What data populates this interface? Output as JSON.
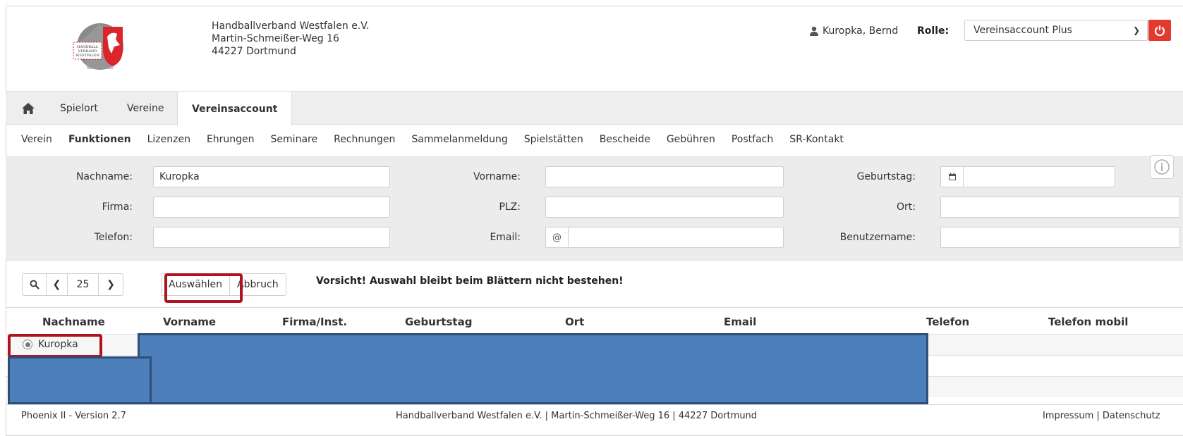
{
  "header": {
    "org_name": "Handballverband Westfalen e.V.",
    "street": "Martin-Schmeißer-Weg 16",
    "city": "44227 Dortmund",
    "logo_text": [
      "HANDBALL",
      "VERBAND",
      "WESTFALEN"
    ],
    "user_name": "Kuropka, Bernd",
    "role_label": "Rolle:",
    "role_value": "Vereinsaccount Plus"
  },
  "tabs": [
    {
      "label": "Spielort"
    },
    {
      "label": "Vereine"
    },
    {
      "label": "Vereinsaccount",
      "active": true
    }
  ],
  "subnav": [
    {
      "label": "Verein"
    },
    {
      "label": "Funktionen",
      "active": true
    },
    {
      "label": "Lizenzen"
    },
    {
      "label": "Ehrungen"
    },
    {
      "label": "Seminare"
    },
    {
      "label": "Rechnungen"
    },
    {
      "label": "Sammelanmeldung"
    },
    {
      "label": "Spielstätten"
    },
    {
      "label": "Bescheide"
    },
    {
      "label": "Gebühren"
    },
    {
      "label": "Postfach"
    },
    {
      "label": "SR-Kontakt"
    }
  ],
  "filter": {
    "nachname_label": "Nachname:",
    "nachname_value": "Kuropka",
    "vorname_label": "Vorname:",
    "vorname_value": "",
    "geburtstag_label": "Geburtstag:",
    "geburtstag_value": "",
    "firma_label": "Firma:",
    "firma_value": "",
    "plz_label": "PLZ:",
    "plz_value": "",
    "ort_label": "Ort:",
    "ort_value": "",
    "telefon_label": "Telefon:",
    "telefon_value": "",
    "email_label": "Email:",
    "email_value": "",
    "email_addon": "@",
    "benutzername_label": "Benutzername:",
    "benutzername_value": ""
  },
  "toolbar": {
    "page_size": "25",
    "select_label": "Auswählen",
    "cancel_label": "Abbruch",
    "warning": "Vorsicht! Auswahl bleibt beim Blättern nicht bestehen!"
  },
  "table": {
    "columns": [
      "Nachname",
      "Vorname",
      "Firma/Inst.",
      "Geburtstag",
      "Ort",
      "Email",
      "Telefon",
      "Telefon mobil"
    ],
    "rows": [
      {
        "nachname": "Kuropka",
        "selected": true
      }
    ]
  },
  "footer": {
    "version": "Phoenix II - Version 2.7",
    "center": "Handballverband Westfalen e.V. | Martin-Schmeißer-Weg 16 | 44227 Dortmund",
    "links": "Impressum | Datenschutz"
  },
  "colors": {
    "accent_red": "#e23a2e",
    "highlight_red": "#b0131f",
    "redaction_blue": "#4d7fbb"
  }
}
